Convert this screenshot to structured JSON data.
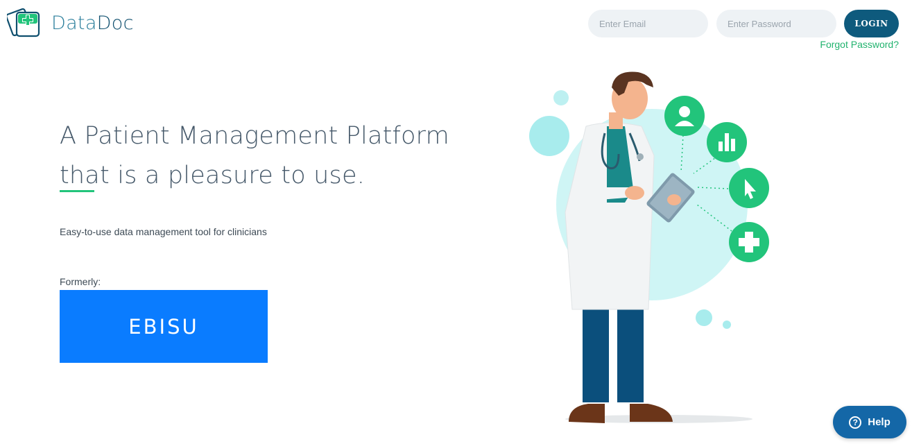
{
  "brand": {
    "name_part1": "Data",
    "name_part2": "Doc"
  },
  "login_form": {
    "email_placeholder": "Enter Email",
    "password_placeholder": "Enter Password",
    "login_label": "LOGIN",
    "forgot_label": "Forgot Password?"
  },
  "hero": {
    "headline_line1": "A Patient Management Platform",
    "headline_line2": "that is a pleasure to use.",
    "subtitle": "Easy-to-use data management tool for clinicians",
    "formerly_label": "Formerly:",
    "former_name": "EBISU"
  },
  "help": {
    "label": "Help",
    "icon": "question-icon"
  },
  "illustration_icons": [
    "user-icon",
    "bar-chart-icon",
    "cursor-icon",
    "medical-cross-icon"
  ],
  "colors": {
    "primary": "#0e5a7d",
    "accent_green": "#22c47b",
    "ebisu_blue": "#0a7cff",
    "help_blue": "#1467a7",
    "teal_light": "#a8eced"
  }
}
